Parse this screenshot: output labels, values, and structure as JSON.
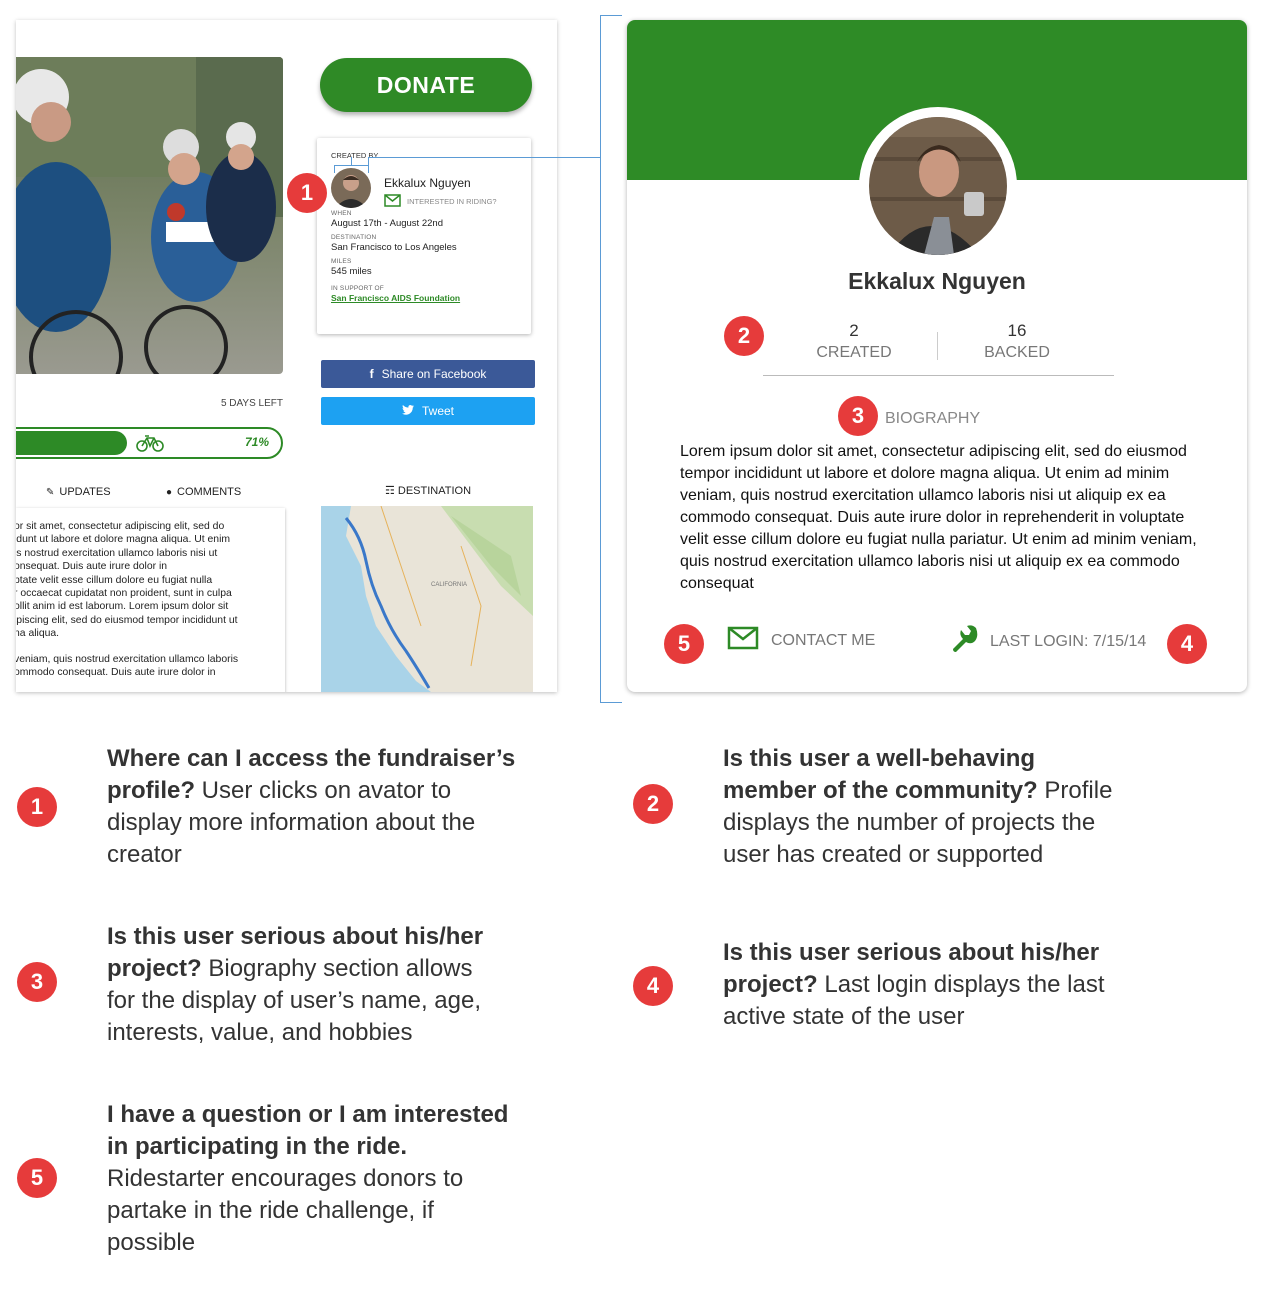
{
  "left_panel": {
    "donate_label": "DONATE",
    "days_left": "5 DAYS LEFT",
    "progress": {
      "value": 71,
      "label": "71%"
    },
    "tabs": [
      {
        "label": "UPDATES",
        "icon": "edit-icon"
      },
      {
        "label": "COMMENTS",
        "icon": "comment-icon"
      }
    ],
    "updates_paragraphs": [
      "or sit amet, consectetur adipiscing elit, sed do\nidunt ut labore et dolore magna aliqua. Ut enim\nis nostrud exercitation ullamco laboris nisi ut\nonsequat. Duis aute irure dolor in\nptate velit esse cillum dolore eu fugiat nulla\nr occaecat cupidatat non proident, sunt in culpa\nollit anim id est laborum. Lorem ipsum dolor sit\nipiscing elit, sed do eiusmod tempor incididunt ut\nna aliqua.",
      "veniam, quis nostrud exercitation ullamco laboris\nommodo consequat. Duis aute irure dolor in"
    ],
    "creator": {
      "created_by_label": "CREATED BY",
      "name": "Ekkalux Nguyen",
      "interested_label": "INTERESTED IN RIDING?",
      "when_label": "WHEN",
      "when": "August 17th - August 22nd",
      "destination_label": "DESTINATION",
      "destination": "San Francisco to Los Angeles",
      "miles_label": "MILES",
      "miles": "545 miles",
      "support_label": "IN SUPPORT OF",
      "support": "San Francisco AIDS Foundation"
    },
    "share_facebook": "Share on Facebook",
    "tweet": "Tweet",
    "destination_tab": "DESTINATION",
    "map_labels": {
      "state": "CALIFORNIA"
    }
  },
  "profile": {
    "name": "Ekkalux Nguyen",
    "stats": [
      {
        "num": "2",
        "label": "CREATED"
      },
      {
        "num": "16",
        "label": "BACKED"
      }
    ],
    "bio_label": "BIOGRAPHY",
    "bio": "Lorem ipsum dolor sit amet, consectetur adipiscing elit, sed do eiusmod tempor incididunt ut labore et dolore magna aliqua. Ut enim ad minim veniam, quis nostrud exercitation ullamco laboris nisi ut aliquip ex ea commodo consequat. Duis aute irure dolor in reprehenderit in voluptate velit esse cillum dolore eu fugiat nulla pariatur. Ut enim ad minim veniam, quis nostrud exercitation ullamco laboris nisi ut aliquip ex ea commodo consequat",
    "contact_label": "CONTACT ME",
    "last_login": "LAST LOGIN: 7/15/14"
  },
  "badges": {
    "b1": "1",
    "b2": "2",
    "b3": "3",
    "b4": "4",
    "b5": "5"
  },
  "annotations": [
    {
      "num": "1",
      "bold": "Where can I access the fundraiser’s profile?",
      "text": " User clicks on avator to display more information about the creator"
    },
    {
      "num": "2",
      "bold": "Is this user a well-behaving member of the community?",
      "text": " Profile displays the number of projects the user has created or supported"
    },
    {
      "num": "3",
      "bold": "Is this user serious about his/her project?",
      "text": " Biography section allows for the display of user’s name, age, interests, value, and hobbies"
    },
    {
      "num": "4",
      "bold": "Is this user serious about his/her project?",
      "text": " Last login displays the last active state of the user"
    },
    {
      "num": "5",
      "bold": "I have a question or I am interested in participating in the ride.",
      "text": " Ridestarter encourages donors to partake in the ride challenge, if possible"
    }
  ],
  "colors": {
    "brand_green": "#2e8b26",
    "badge_red": "#e63b3b",
    "facebook": "#3b5998",
    "twitter": "#1da1f2",
    "connector": "#5b9bd5"
  }
}
